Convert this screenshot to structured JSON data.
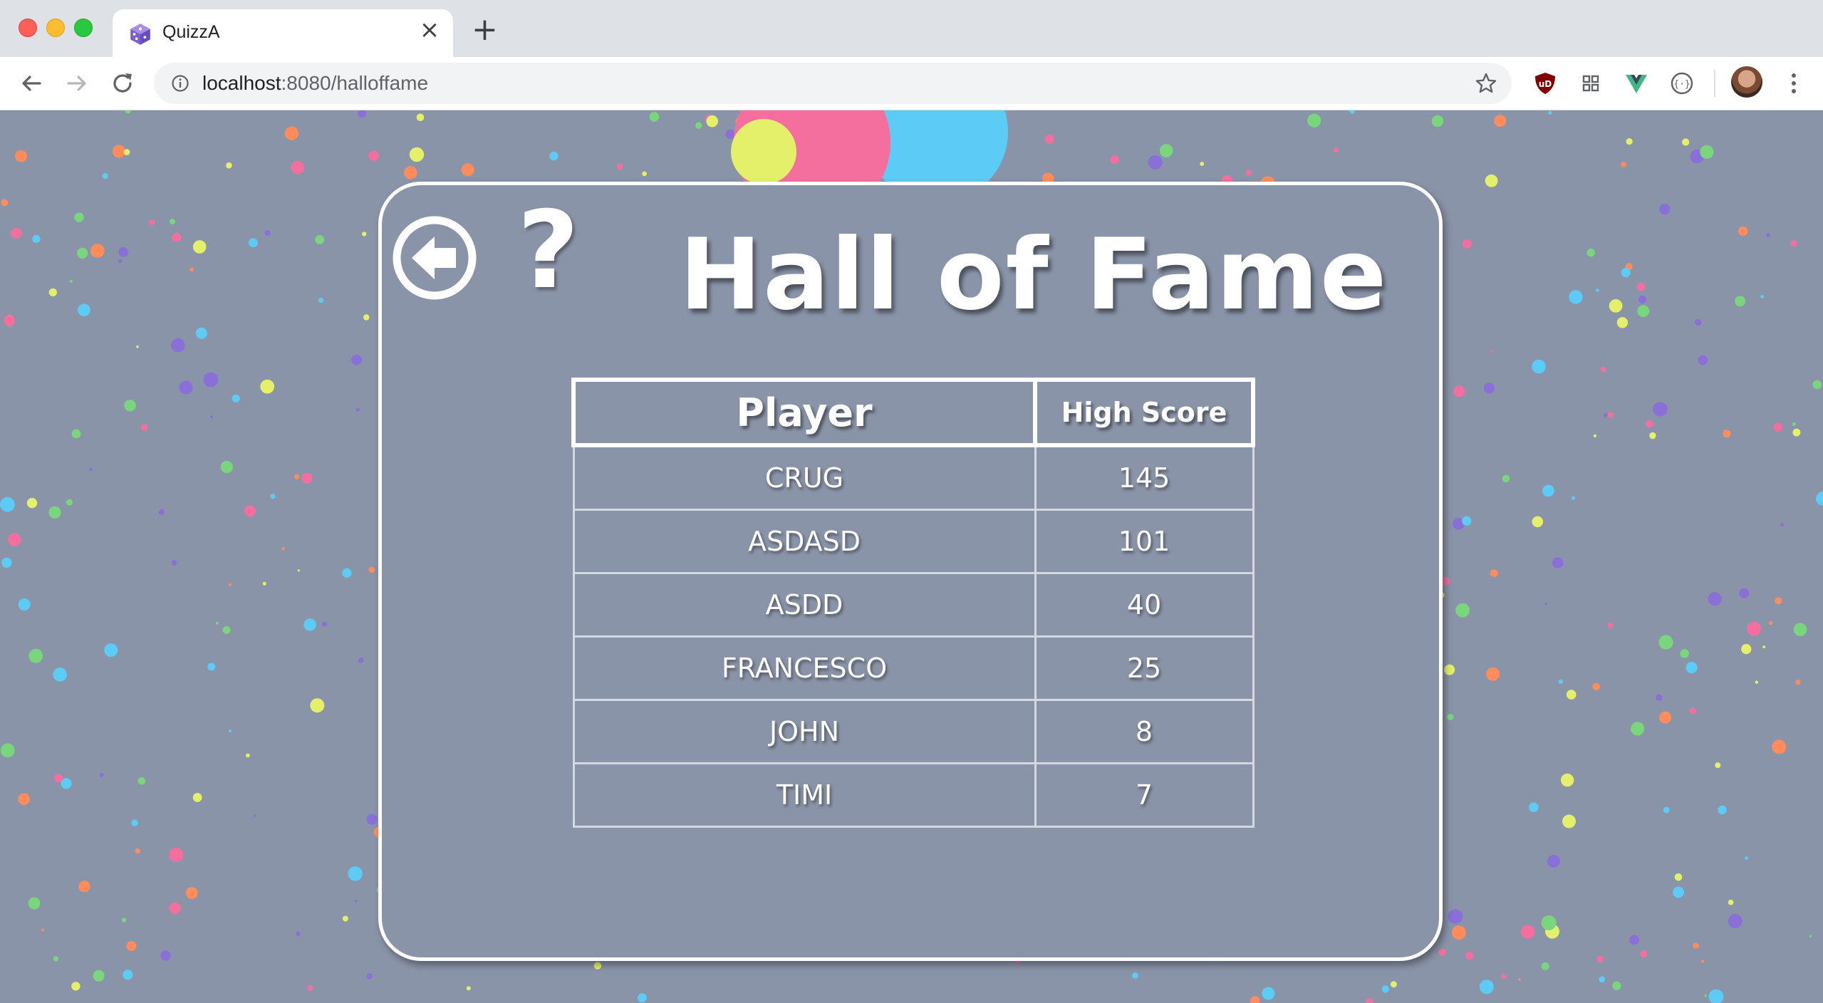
{
  "browser": {
    "tab": {
      "title": "QuizzA",
      "favicon": "dice-icon"
    },
    "url": {
      "host": "localhost",
      "rest": ":8080/halloffame"
    },
    "icons": [
      "back-arrow-icon",
      "forward-arrow-icon",
      "reload-icon",
      "info-icon",
      "star-icon",
      "ublock-icon",
      "grid-icon",
      "vue-devtools-icon",
      "code-icon",
      "avatar",
      "menu-dots-icon"
    ]
  },
  "page": {
    "title": "Hall of Fame",
    "back_icon": "arrow-left-circle-icon",
    "help_label": "?",
    "table": {
      "headers": {
        "player": "Player",
        "score": "High Score"
      },
      "rows": [
        {
          "player": "CRUG",
          "score": "145"
        },
        {
          "player": "ASDASD",
          "score": "101"
        },
        {
          "player": "ASDD",
          "score": "40"
        },
        {
          "player": "FRANCESCO",
          "score": "25"
        },
        {
          "player": "JOHN",
          "score": "8"
        },
        {
          "player": "TIMI",
          "score": "7"
        }
      ]
    }
  },
  "colors": {
    "background": "#8a94a8",
    "confetti": [
      "#f56f9e",
      "#5ccbf5",
      "#e4f06a",
      "#ff8c5a",
      "#7ad67d",
      "#8a6fd8"
    ]
  }
}
